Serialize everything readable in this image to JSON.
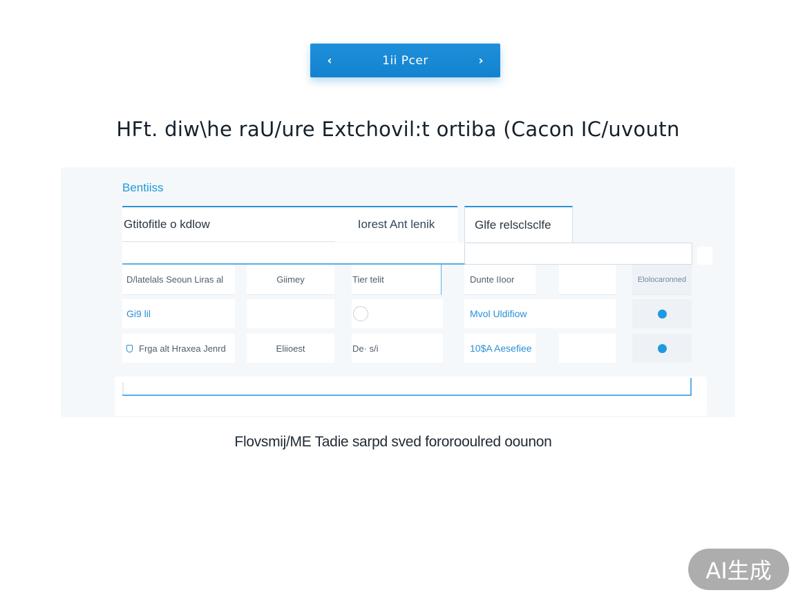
{
  "pager": {
    "prev_glyph": "‹",
    "label": "1ii Pcer",
    "next_glyph": "›"
  },
  "headline": "HFt. diw\\he raU/ure Extchovil:t ortiba (Cacon IC/uvoutn",
  "card": {
    "title": "Bentiiss",
    "tabs": [
      {
        "label": "Gtitofitle o kdlow"
      },
      {
        "label": "Iorest Ant lenik"
      },
      {
        "label": "Glfe relsclsclfe"
      }
    ],
    "rows": [
      {
        "c1": "D/latelals Seoun Liras al",
        "c2": "Giimey",
        "c3": "Tier telit",
        "c4": "Dunte IIoor",
        "c5": "",
        "c6": "Elolocaronned"
      },
      {
        "c1": "Gi9        lil",
        "c2": "",
        "c3": "",
        "c4": "Mvol Uldifiow",
        "c5": "",
        "c6": ""
      },
      {
        "c1": "Frga alt Hraxea Jenrd",
        "c2": "Eliioest",
        "c3": "De·  s/i",
        "c4": "10$A  Aesefiee",
        "c5": "",
        "c6": ""
      }
    ]
  },
  "caption": "Flovsmij/ME Tadie sarpd sved fororooulred oounon",
  "watermark": "AI生成",
  "colors": {
    "accent": "#1e9bd7",
    "primary_button": "#1a8ad7",
    "status_dot": "#1e9be0",
    "card_background": "#f5f8fb"
  },
  "icons": {
    "pager_prev": "chevron-left-icon",
    "pager_next": "chevron-right-icon",
    "row3_badge": "shield-icon"
  }
}
